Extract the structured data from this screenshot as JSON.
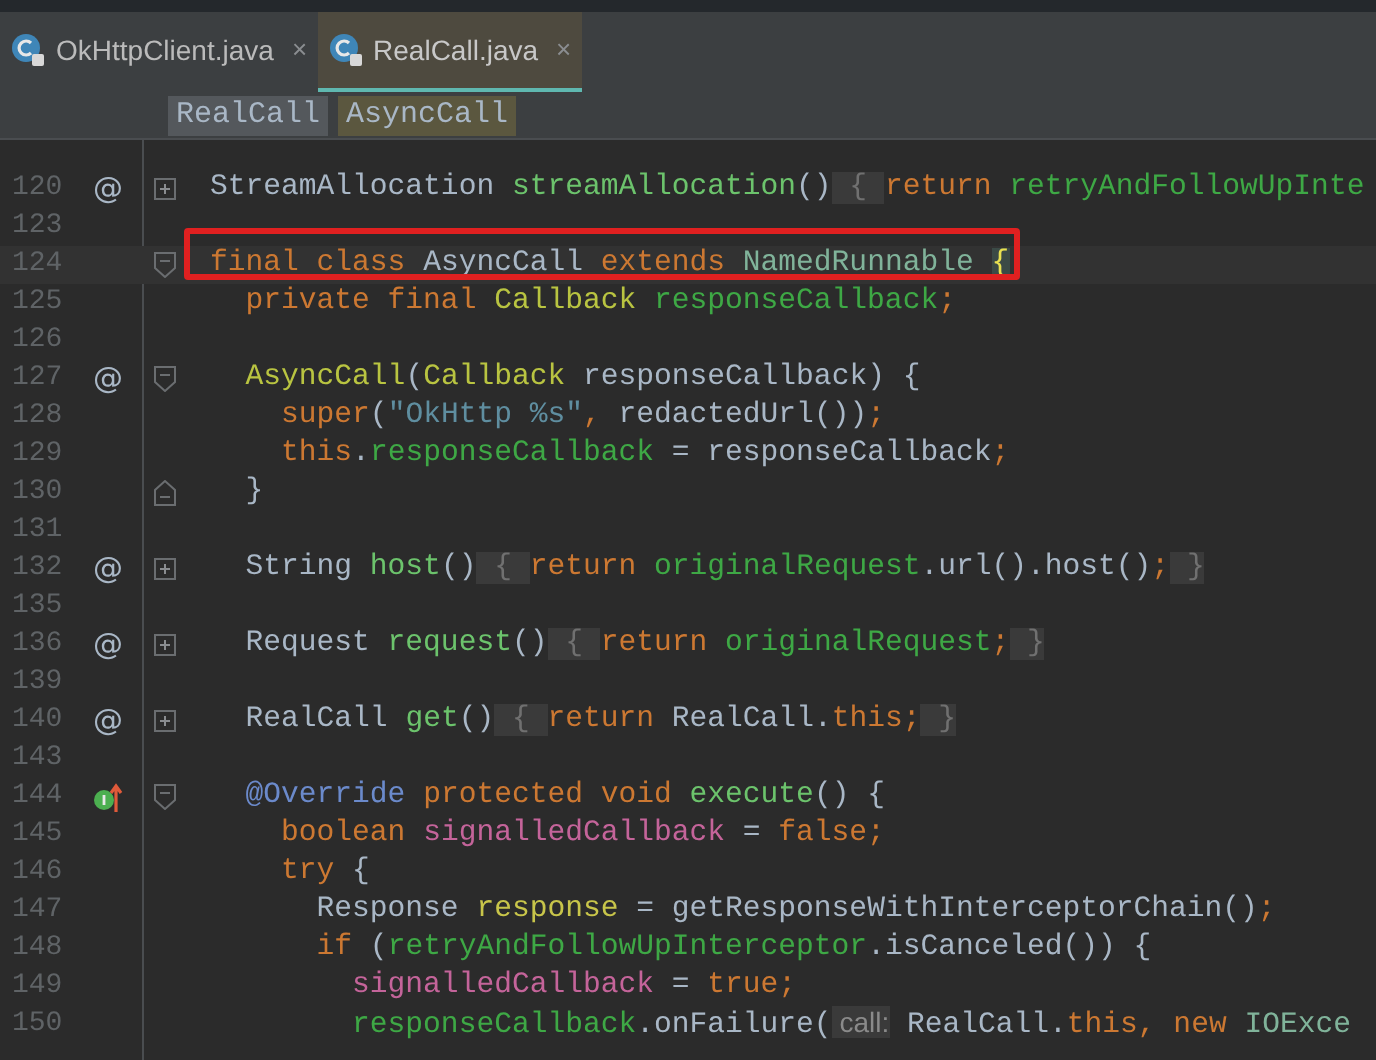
{
  "tabs": [
    {
      "label": "OkHttpClient.java",
      "close": "×",
      "selected": false
    },
    {
      "label": "RealCall.java",
      "close": "×",
      "selected": true
    }
  ],
  "breadcrumbs": [
    {
      "label": "RealCall",
      "selected": false
    },
    {
      "label": "AsyncCall",
      "selected": true
    }
  ],
  "lines": [
    {
      "number": "120",
      "marker": "@",
      "fold": {
        "kind": "collapsed"
      },
      "tokens": [
        {
          "text": "StreamAllocation ",
          "kind": "plain"
        },
        {
          "text": "streamAllocation",
          "kind": "method"
        },
        {
          "text": "()",
          "kind": "plain"
        },
        {
          "text": " { ",
          "kind": "chip"
        },
        {
          "text": "return ",
          "kind": "keyword"
        },
        {
          "text": "retryAndFollowUpInte",
          "kind": "field"
        }
      ]
    },
    {
      "number": "123"
    },
    {
      "number": "124",
      "fold": {
        "kind": "start"
      },
      "current": true,
      "boxed": true,
      "tokens": [
        {
          "text": "final class ",
          "kind": "keyword"
        },
        {
          "text": "AsyncCall ",
          "kind": "plain"
        },
        {
          "text": "extends ",
          "kind": "keyword"
        },
        {
          "text": "NamedRunnable ",
          "kind": "type2"
        },
        {
          "text": "{",
          "kind": "brace_match"
        }
      ]
    },
    {
      "number": "125",
      "tokens": [
        {
          "text": "  private final ",
          "kind": "keyword"
        },
        {
          "text": "Callback ",
          "kind": "type"
        },
        {
          "text": "responseCallback",
          "kind": "field"
        },
        {
          "text": ";",
          "kind": "keyword"
        }
      ]
    },
    {
      "number": "126"
    },
    {
      "number": "127",
      "marker": "@",
      "fold": {
        "kind": "start"
      },
      "tokens": [
        {
          "text": "  AsyncCall",
          "kind": "type"
        },
        {
          "text": "(",
          "kind": "plain"
        },
        {
          "text": "Callback ",
          "kind": "type"
        },
        {
          "text": "responseCallback) {",
          "kind": "plain"
        }
      ]
    },
    {
      "number": "128",
      "tokens": [
        {
          "text": "    super",
          "kind": "keyword"
        },
        {
          "text": "(",
          "kind": "plain"
        },
        {
          "text": "\"OkHttp %s\"",
          "kind": "string"
        },
        {
          "text": ", ",
          "kind": "keyword"
        },
        {
          "text": "redactedUrl())",
          "kind": "plain"
        },
        {
          "text": ";",
          "kind": "keyword"
        }
      ]
    },
    {
      "number": "129",
      "tokens": [
        {
          "text": "    this",
          "kind": "keyword"
        },
        {
          "text": ".",
          "kind": "plain"
        },
        {
          "text": "responseCallback",
          "kind": "field"
        },
        {
          "text": " = responseCallback",
          "kind": "plain"
        },
        {
          "text": ";",
          "kind": "keyword"
        }
      ]
    },
    {
      "number": "130",
      "fold": {
        "kind": "end"
      },
      "tokens": [
        {
          "text": "  }",
          "kind": "plain"
        }
      ]
    },
    {
      "number": "131"
    },
    {
      "number": "132",
      "marker": "@",
      "fold": {
        "kind": "collapsed"
      },
      "tokens": [
        {
          "text": "  String ",
          "kind": "plain"
        },
        {
          "text": "host",
          "kind": "method"
        },
        {
          "text": "()",
          "kind": "plain"
        },
        {
          "text": " { ",
          "kind": "chip"
        },
        {
          "text": "return ",
          "kind": "keyword"
        },
        {
          "text": "originalRequest",
          "kind": "field"
        },
        {
          "text": ".url().host()",
          "kind": "plain"
        },
        {
          "text": ";",
          "kind": "keyword"
        },
        {
          "text": " }",
          "kind": "chip"
        }
      ]
    },
    {
      "number": "135"
    },
    {
      "number": "136",
      "marker": "@",
      "fold": {
        "kind": "collapsed"
      },
      "tokens": [
        {
          "text": "  Request ",
          "kind": "plain"
        },
        {
          "text": "request",
          "kind": "method"
        },
        {
          "text": "()",
          "kind": "plain"
        },
        {
          "text": " { ",
          "kind": "chip"
        },
        {
          "text": "return ",
          "kind": "keyword"
        },
        {
          "text": "originalRequest",
          "kind": "field"
        },
        {
          "text": ";",
          "kind": "keyword"
        },
        {
          "text": " }",
          "kind": "chip"
        }
      ]
    },
    {
      "number": "139"
    },
    {
      "number": "140",
      "marker": "@",
      "fold": {
        "kind": "collapsed"
      },
      "tokens": [
        {
          "text": "  RealCall ",
          "kind": "plain"
        },
        {
          "text": "get",
          "kind": "method"
        },
        {
          "text": "()",
          "kind": "plain"
        },
        {
          "text": " { ",
          "kind": "chip"
        },
        {
          "text": "return ",
          "kind": "keyword"
        },
        {
          "text": "RealCall.",
          "kind": "plain"
        },
        {
          "text": "this",
          "kind": "keyword"
        },
        {
          "text": ";",
          "kind": "keyword"
        },
        {
          "text": " }",
          "kind": "chip"
        }
      ]
    },
    {
      "number": "143"
    },
    {
      "number": "144",
      "gutter_icon": {
        "kind": "implements"
      },
      "fold": {
        "kind": "start"
      },
      "tokens": [
        {
          "text": "  @Override ",
          "kind": "annotation"
        },
        {
          "text": "protected void ",
          "kind": "keyword"
        },
        {
          "text": "execute",
          "kind": "method"
        },
        {
          "text": "() {",
          "kind": "plain"
        }
      ]
    },
    {
      "number": "145",
      "tokens": [
        {
          "text": "    boolean ",
          "kind": "keyword"
        },
        {
          "text": "signalledCallback",
          "kind": "local"
        },
        {
          "text": " = ",
          "kind": "plain"
        },
        {
          "text": "false;",
          "kind": "keyword"
        }
      ]
    },
    {
      "number": "146",
      "tokens": [
        {
          "text": "    try ",
          "kind": "keyword"
        },
        {
          "text": "{",
          "kind": "plain"
        }
      ]
    },
    {
      "number": "147",
      "tokens": [
        {
          "text": "      Response ",
          "kind": "plain"
        },
        {
          "text": "response",
          "kind": "param"
        },
        {
          "text": " = getResponseWithInterceptorChain()",
          "kind": "plain"
        },
        {
          "text": ";",
          "kind": "keyword"
        }
      ]
    },
    {
      "number": "148",
      "tokens": [
        {
          "text": "      if ",
          "kind": "keyword"
        },
        {
          "text": "(",
          "kind": "plain"
        },
        {
          "text": "retryAndFollowUpInterceptor",
          "kind": "field"
        },
        {
          "text": ".isCanceled()) {",
          "kind": "plain"
        }
      ]
    },
    {
      "number": "149",
      "tokens": [
        {
          "text": "        signalledCallback",
          "kind": "local"
        },
        {
          "text": " = ",
          "kind": "plain"
        },
        {
          "text": "true;",
          "kind": "keyword"
        }
      ]
    },
    {
      "number": "150",
      "tokens": [
        {
          "text": "        responseCallback",
          "kind": "field"
        },
        {
          "text": ".onFailure(",
          "kind": "plain"
        },
        {
          "text": " call:",
          "kind": "hint"
        },
        {
          "text": " RealCall.",
          "kind": "plain"
        },
        {
          "text": "this, new ",
          "kind": "keyword"
        },
        {
          "text": "IOExce",
          "kind": "type2"
        }
      ]
    }
  ]
}
